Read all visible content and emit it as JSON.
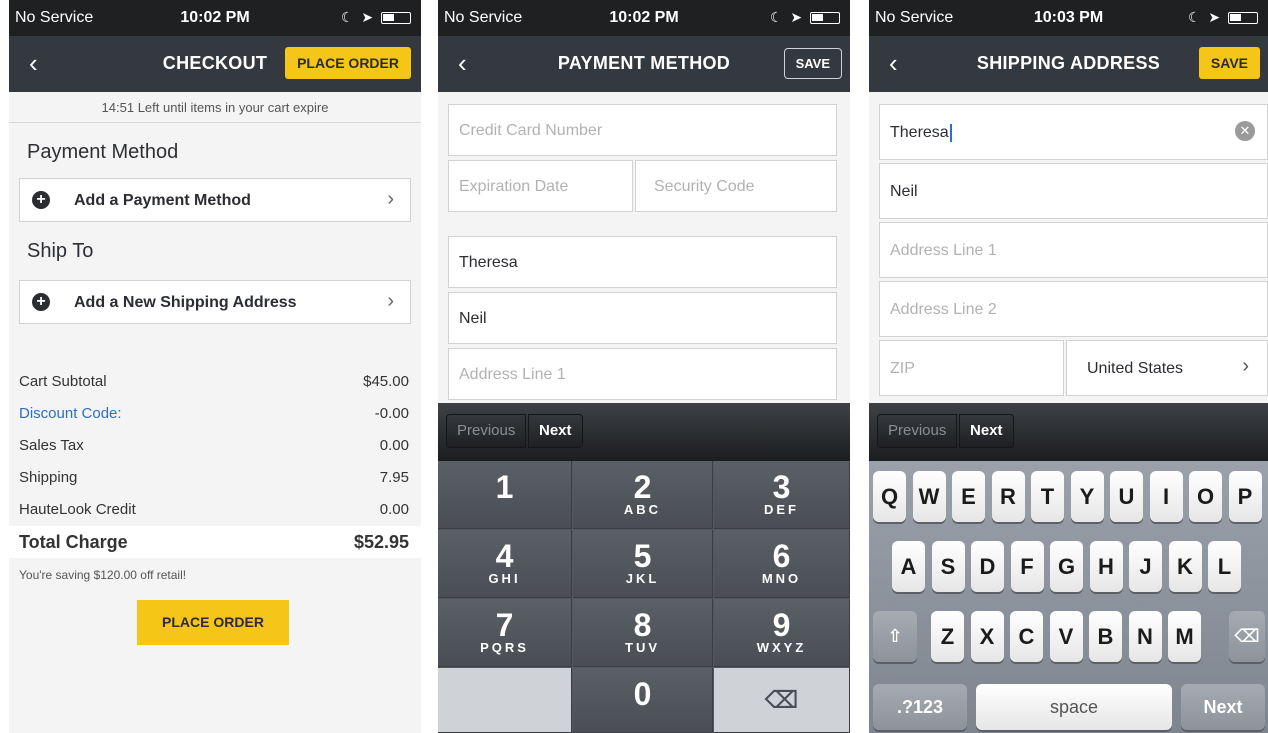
{
  "status": {
    "s1": {
      "carrier": "No Service",
      "time": "10:02 PM"
    },
    "s2": {
      "carrier": "No Service",
      "time": "10:02 PM"
    },
    "s3": {
      "carrier": "No Service",
      "time": "10:03 PM"
    }
  },
  "checkout": {
    "title": "CHECKOUT",
    "place_order_top": "PLACE ORDER",
    "expire_text": "14:51 Left until items in your cart expire",
    "payment_title": "Payment Method",
    "add_payment": "Add a Payment Method",
    "ship_title": "Ship To",
    "add_shipping": "Add a New Shipping Address",
    "summary": [
      {
        "label": "Cart Subtotal",
        "value": "$45.00"
      },
      {
        "label": "Discount Code:",
        "value": "-0.00"
      },
      {
        "label": "Sales Tax",
        "value": "0.00"
      },
      {
        "label": "Shipping",
        "value": "7.95"
      },
      {
        "label": "HauteLook Credit",
        "value": "0.00"
      }
    ],
    "total_label": "Total Charge",
    "total_value": "$52.95",
    "saving_text": "You're saving $120.00 off retail!",
    "place_order_bottom": "PLACE ORDER"
  },
  "payment": {
    "title": "PAYMENT METHOD",
    "save": "SAVE",
    "card_ph": "Credit Card Number",
    "exp_ph": "Expiration Date",
    "sec_ph": "Security Code",
    "first_name": "Theresa",
    "last_name": "Neil",
    "addr1_ph": "Address Line 1",
    "prev": "Previous",
    "next": "Next",
    "keys": [
      {
        "d": "1",
        "l": ""
      },
      {
        "d": "2",
        "l": "ABC"
      },
      {
        "d": "3",
        "l": "DEF"
      },
      {
        "d": "4",
        "l": "GHI"
      },
      {
        "d": "5",
        "l": "JKL"
      },
      {
        "d": "6",
        "l": "MNO"
      },
      {
        "d": "7",
        "l": "PQRS"
      },
      {
        "d": "8",
        "l": "TUV"
      },
      {
        "d": "9",
        "l": "WXYZ"
      },
      {
        "d": "",
        "l": ""
      },
      {
        "d": "0",
        "l": ""
      },
      {
        "d": "⌫",
        "l": ""
      }
    ]
  },
  "shipping": {
    "title": "SHIPPING ADDRESS",
    "save": "SAVE",
    "first_name": "Theresa",
    "last_name": "Neil",
    "addr1_ph": "Address Line 1",
    "addr2_ph": "Address Line 2",
    "zip_ph": "ZIP",
    "country": "United States",
    "prev": "Previous",
    "next": "Next",
    "row1": [
      "Q",
      "W",
      "E",
      "R",
      "T",
      "Y",
      "U",
      "I",
      "O",
      "P"
    ],
    "row2": [
      "A",
      "S",
      "D",
      "F",
      "G",
      "H",
      "J",
      "K",
      "L"
    ],
    "row3": [
      "Z",
      "X",
      "C",
      "V",
      "B",
      "N",
      "M"
    ],
    "numbers_key": ".?123",
    "space_key": "space",
    "next_key": "Next"
  }
}
